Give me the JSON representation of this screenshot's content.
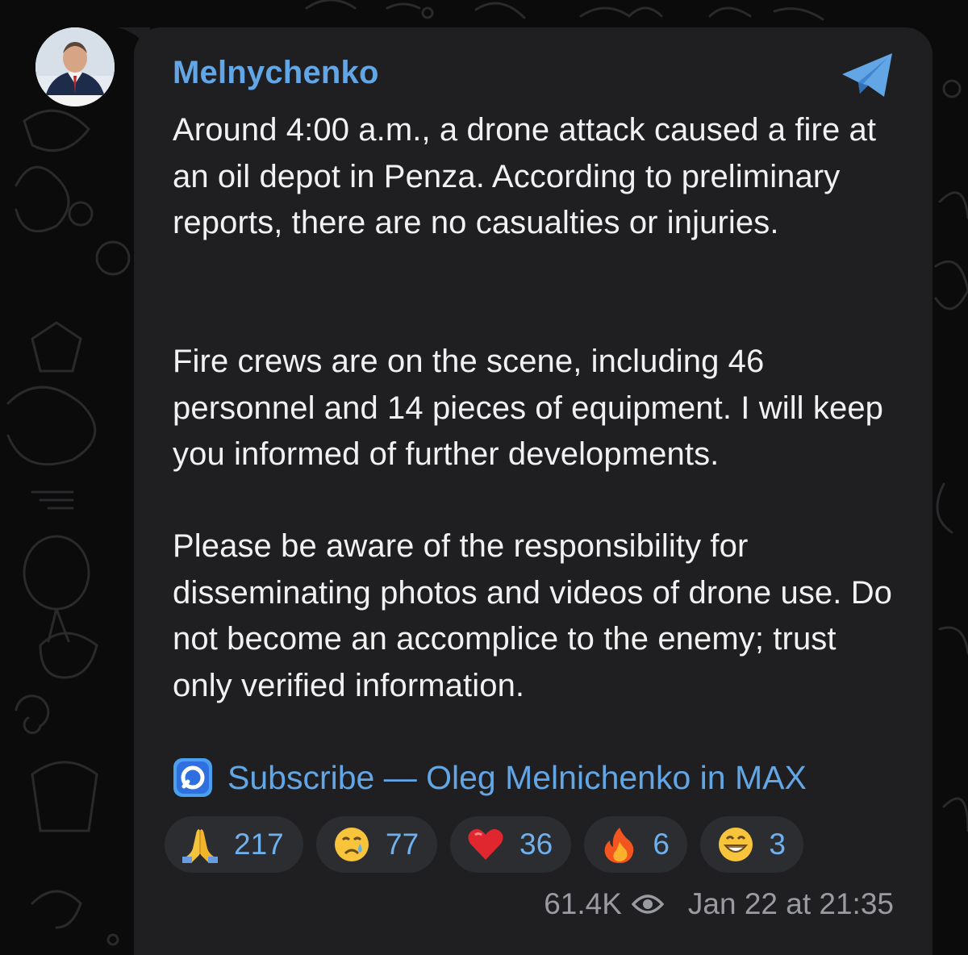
{
  "channel": {
    "name": "Melnychenko"
  },
  "message": {
    "paragraphs": [
      "Around 4:00 a.m., a drone attack caused a fire at an oil depot in Penza. According to preliminary reports, there are no casualties or injuries.",
      "Fire crews are on the scene, including 46 personnel and 14 pieces of equipment. I will keep you informed of further developments.",
      "Please be aware of the responsibility for disseminating photos and videos of drone use. Do not become an accomplice to the enemy; trust only verified information."
    ],
    "subscribe_link": "Subscribe — Oleg Melnichenko in MAX"
  },
  "reactions": [
    {
      "emoji": "folded-hands",
      "count": "217"
    },
    {
      "emoji": "crying-face",
      "count": "77"
    },
    {
      "emoji": "red-heart",
      "count": "36"
    },
    {
      "emoji": "fire",
      "count": "6"
    },
    {
      "emoji": "grinning-face",
      "count": "3"
    }
  ],
  "meta": {
    "views": "61.4K",
    "timestamp": "Jan 22 at 21:35"
  },
  "colors": {
    "accent": "#62a6e6",
    "bubble": "#1f1f21",
    "background": "#0b0b0c",
    "reaction_pill": "#2c2d31"
  }
}
